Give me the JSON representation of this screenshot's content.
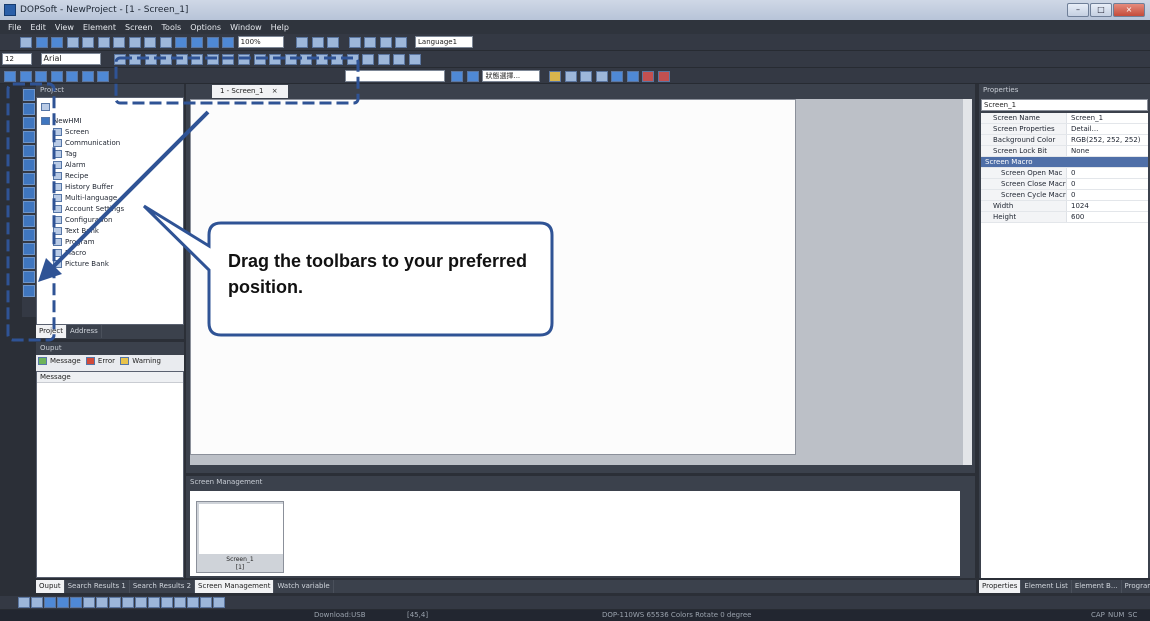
{
  "window": {
    "title": "DOPSoft - NewProject - [1 - Screen_1]",
    "min": "–",
    "max": "□",
    "close": "×"
  },
  "menu": [
    "File",
    "Edit",
    "View",
    "Element",
    "Screen",
    "Tools",
    "Options",
    "Window",
    "Help"
  ],
  "toolbar": {
    "zoom": "100%",
    "language": "Language1",
    "font_size": "12",
    "font_name": "Arial",
    "state_combo": "狀態選擇..."
  },
  "project_panel": {
    "title": "Project",
    "root": "NewHMI",
    "items": [
      "Screen",
      "Communication",
      "Tag",
      "Alarm",
      "Recipe",
      "History Buffer",
      "Multi-language",
      "Account Settings",
      "Configuration",
      "Text Bank",
      "Program",
      "Macro",
      "Picture Bank"
    ],
    "tabs": [
      "Project",
      "Address"
    ]
  },
  "output_panel": {
    "title": "Ouput",
    "filters": [
      "Message",
      "Error",
      "Warning"
    ],
    "column": "Message"
  },
  "editor": {
    "tab_label": "1 - Screen_1",
    "tab_close": "×"
  },
  "screen_management": {
    "title": "Screen Management",
    "thumb_name": "Screen_1",
    "thumb_index": "[1]"
  },
  "properties": {
    "title": "Properties",
    "selector": "Screen_1",
    "rows": [
      {
        "key": "Screen Name",
        "value": "Screen_1"
      },
      {
        "key": "Screen Properties",
        "value": "Detail..."
      },
      {
        "key": "Background Color",
        "value": "RGB(252, 252, 252)"
      },
      {
        "key": "Screen Lock Bit",
        "value": "None"
      }
    ],
    "group": "Screen Macro",
    "macro_rows": [
      {
        "key": "Screen Open Mac",
        "value": "0"
      },
      {
        "key": "Screen Close Macr",
        "value": "0"
      },
      {
        "key": "Screen Cycle Macr",
        "value": "0"
      }
    ],
    "size_rows": [
      {
        "key": "Width",
        "value": "1024"
      },
      {
        "key": "Height",
        "value": "600"
      }
    ],
    "bottom_tabs": [
      "Properties",
      "Element List",
      "Element B...",
      "Program ..."
    ]
  },
  "bottom_tabs": [
    "Ouput",
    "Search Results 1",
    "Search Results 2",
    "Screen Management",
    "Watch variable"
  ],
  "status_bar": {
    "download": "Download:USB",
    "coords": "[45,4]",
    "device": "DOP-110WS 65536 Colors Rotate 0 degree",
    "cap": "CAP",
    "num": "NUM",
    "scrl": "SC"
  },
  "callout": {
    "text": "Drag the toolbars to your preferred position."
  },
  "colors": {
    "callout_border": "#2f5395",
    "arrow": "#2f5395"
  }
}
